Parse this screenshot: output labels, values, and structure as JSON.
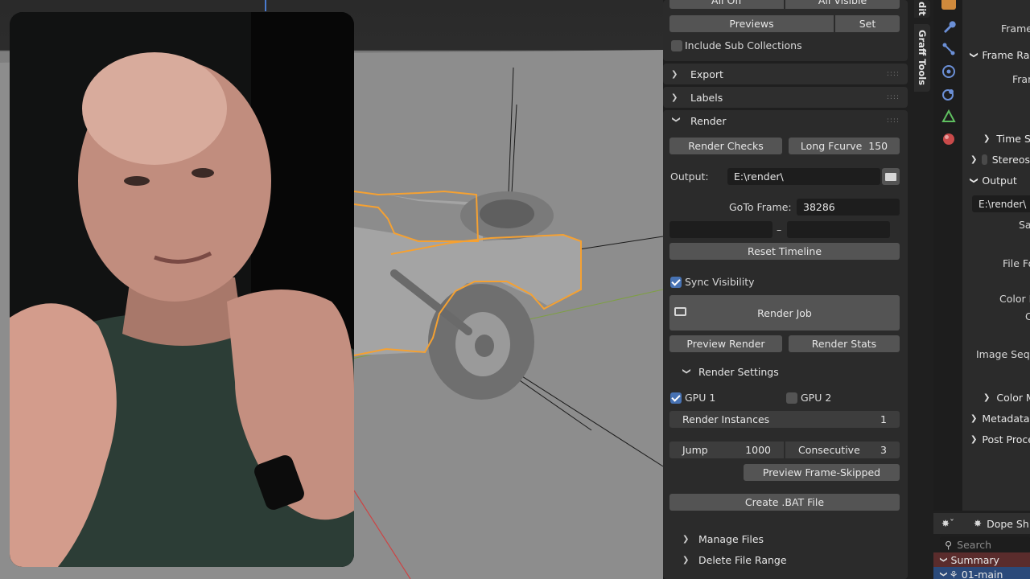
{
  "top_buttons": {
    "all_off": "All Off",
    "all_visible": "All Visible",
    "previews": "Previews",
    "set": "Set"
  },
  "include_sub_collections": {
    "label": "Include Sub Collections",
    "checked": false
  },
  "sections": {
    "export": "Export",
    "labels": "Labels",
    "render": "Render"
  },
  "render": {
    "render_checks": "Render Checks",
    "long_fcurve_label": "Long Fcurve",
    "long_fcurve_value": "150",
    "output_label": "Output:",
    "output_value": "E:\\render\\",
    "goto_label": "GoTo Frame:",
    "goto_value": "38286",
    "range_dash": "–",
    "reset_timeline": "Reset Timeline",
    "sync_visibility": "Sync Visibility",
    "render_job": "Render Job",
    "preview_render": "Preview Render",
    "render_stats": "Render Stats"
  },
  "render_settings": {
    "title": "Render Settings",
    "gpu1": "GPU 1",
    "gpu2": "GPU 2",
    "render_instances_label": "Render Instances",
    "render_instances_value": "1",
    "jump_label": "Jump",
    "jump_value": "1000",
    "consecutive_label": "Consecutive",
    "consecutive_value": "3",
    "preview_frame_skipped": "Preview Frame-Skipped",
    "create_bat": "Create .BAT File",
    "manage_files": "Manage Files",
    "delete_file_range": "Delete File Range"
  },
  "tabs": {
    "edit": "dit",
    "graff_tools": "Graff Tools"
  },
  "properties": {
    "frame": "Frame",
    "frame_range": "Frame Ran",
    "frame2": "Frame",
    "time_stretching": "Time St",
    "stereoscopy": "Stereos",
    "output": "Output",
    "output_path": "E:\\render\\",
    "save": "Sa",
    "file_format": "File Fo",
    "color_d": "Color D",
    "c": "C",
    "image_sequence": "Image Sequ",
    "color_management": "Color M",
    "metadata": "Metadata",
    "post_processing": "Post Proce"
  },
  "dope_sheet": {
    "mode": "Dope Sh",
    "search_placeholder": "Search",
    "summary": "Summary",
    "action": "01-main"
  },
  "colors": {
    "selection_outline": "#f5a132",
    "accent_blue": "#4772b3",
    "panel_bg": "#2b2b2b",
    "button": "#545454"
  }
}
